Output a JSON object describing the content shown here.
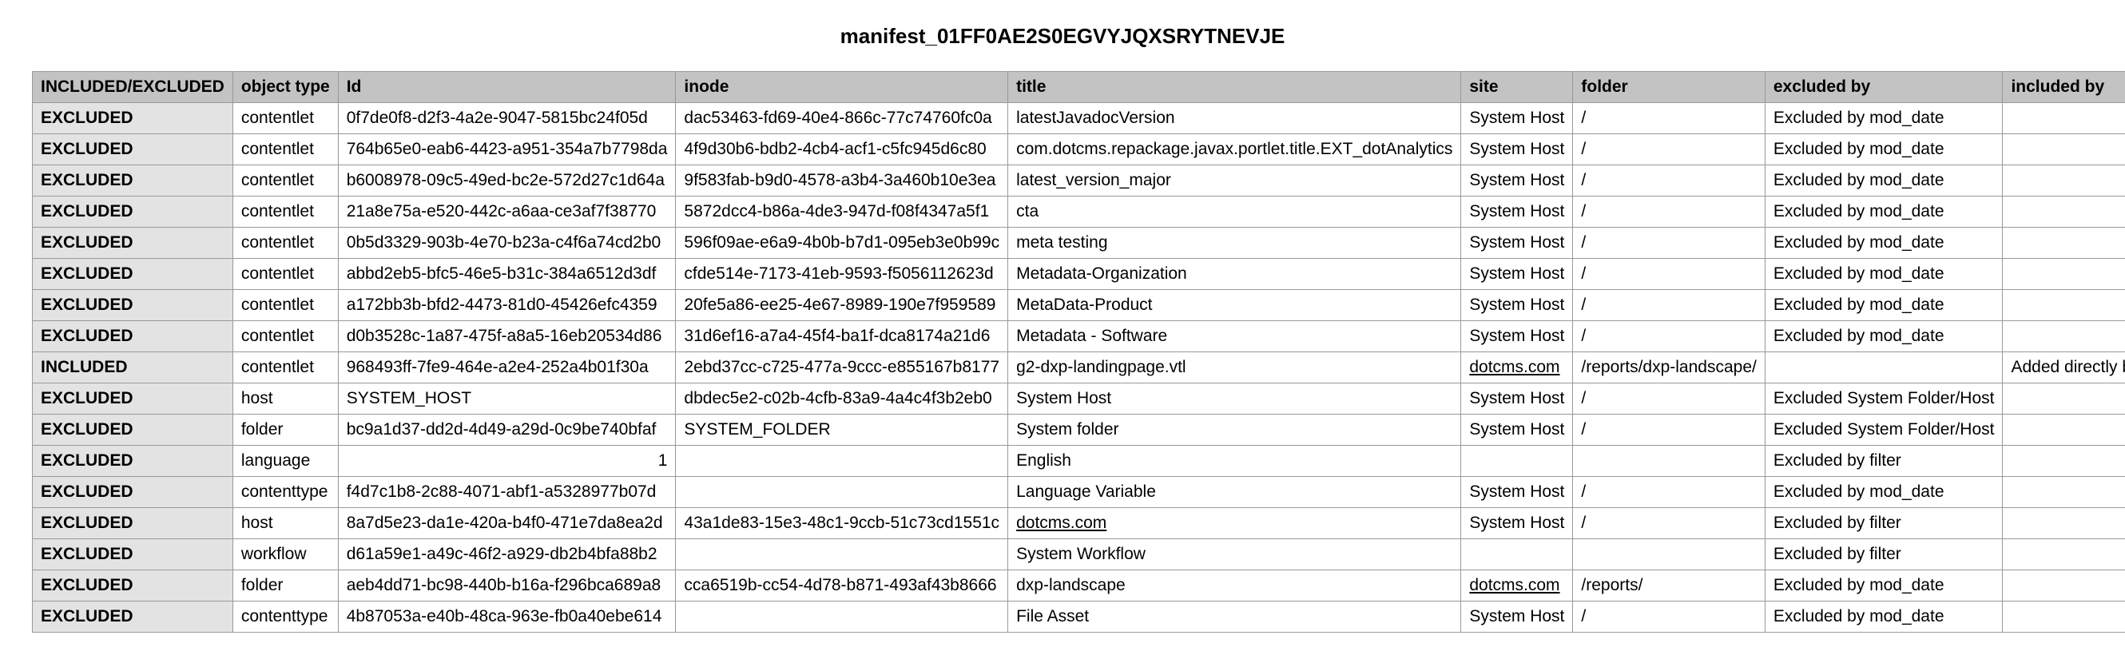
{
  "title": "manifest_01FF0AE2S0EGVYJQXSRYTNEVJE",
  "columns": [
    "INCLUDED/EXCLUDED",
    "object type",
    "Id",
    "inode",
    "title",
    "site",
    "folder",
    "excluded by",
    "included by"
  ],
  "rows": [
    {
      "status": "EXCLUDED",
      "type": "contentlet",
      "id": "0f7de0f8-d2f3-4a2e-9047-5815bc24f05d",
      "inode": "dac53463-fd69-40e4-866c-77c74760fc0a",
      "title": "latestJavadocVersion",
      "site": "System Host",
      "site_link": false,
      "folder": "/",
      "excluded": "Excluded by mod_date",
      "included": "",
      "id_right": false
    },
    {
      "status": "EXCLUDED",
      "type": "contentlet",
      "id": "764b65e0-eab6-4423-a951-354a7b7798da",
      "inode": "4f9d30b6-bdb2-4cb4-acf1-c5fc945d6c80",
      "title": "com.dotcms.repackage.javax.portlet.title.EXT_dotAnalytics",
      "site": "System Host",
      "site_link": false,
      "folder": "/",
      "excluded": "Excluded by mod_date",
      "included": "",
      "id_right": false
    },
    {
      "status": "EXCLUDED",
      "type": "contentlet",
      "id": "b6008978-09c5-49ed-bc2e-572d27c1d64a",
      "inode": "9f583fab-b9d0-4578-a3b4-3a460b10e3ea",
      "title": "latest_version_major",
      "site": "System Host",
      "site_link": false,
      "folder": "/",
      "excluded": "Excluded by mod_date",
      "included": "",
      "id_right": false
    },
    {
      "status": "EXCLUDED",
      "type": "contentlet",
      "id": "21a8e75a-e520-442c-a6aa-ce3af7f38770",
      "inode": "5872dcc4-b86a-4de3-947d-f08f4347a5f1",
      "title": "cta",
      "site": "System Host",
      "site_link": false,
      "folder": "/",
      "excluded": "Excluded by mod_date",
      "included": "",
      "id_right": false
    },
    {
      "status": "EXCLUDED",
      "type": "contentlet",
      "id": "0b5d3329-903b-4e70-b23a-c4f6a74cd2b0",
      "inode": "596f09ae-e6a9-4b0b-b7d1-095eb3e0b99c",
      "title": "meta testing",
      "site": "System Host",
      "site_link": false,
      "folder": "/",
      "excluded": "Excluded by mod_date",
      "included": "",
      "id_right": false
    },
    {
      "status": "EXCLUDED",
      "type": "contentlet",
      "id": "abbd2eb5-bfc5-46e5-b31c-384a6512d3df",
      "inode": "cfde514e-7173-41eb-9593-f5056112623d",
      "title": "Metadata-Organization",
      "site": "System Host",
      "site_link": false,
      "folder": "/",
      "excluded": "Excluded by mod_date",
      "included": "",
      "id_right": false
    },
    {
      "status": "EXCLUDED",
      "type": "contentlet",
      "id": "a172bb3b-bfd2-4473-81d0-45426efc4359",
      "inode": "20fe5a86-ee25-4e67-8989-190e7f959589",
      "title": "MetaData-Product",
      "site": "System Host",
      "site_link": false,
      "folder": "/",
      "excluded": "Excluded by mod_date",
      "included": "",
      "id_right": false
    },
    {
      "status": "EXCLUDED",
      "type": "contentlet",
      "id": "d0b3528c-1a87-475f-a8a5-16eb20534d86",
      "inode": "31d6ef16-a7a4-45f4-ba1f-dca8174a21d6",
      "title": "Metadata - Software",
      "site": "System Host",
      "site_link": false,
      "folder": "/",
      "excluded": "Excluded by mod_date",
      "included": "",
      "id_right": false
    },
    {
      "status": "INCLUDED",
      "type": "contentlet",
      "id": "968493ff-7fe9-464e-a2e4-252a4b01f30a",
      "inode": "2ebd37cc-c725-477a-9ccc-e855167b8177",
      "title": "g2-dxp-landingpage.vtl",
      "site": "dotcms.com",
      "site_link": true,
      "folder": "/reports/dxp-landscape/",
      "excluded": "",
      "included": "Added directly by User",
      "id_right": false
    },
    {
      "status": "EXCLUDED",
      "type": "host",
      "id": "SYSTEM_HOST",
      "inode": "dbdec5e2-c02b-4cfb-83a9-4a4c4f3b2eb0",
      "title": "System Host",
      "site": "System Host",
      "site_link": false,
      "folder": "/",
      "excluded": "Excluded System Folder/Host",
      "included": "",
      "id_right": false
    },
    {
      "status": "EXCLUDED",
      "type": "folder",
      "id": "bc9a1d37-dd2d-4d49-a29d-0c9be740bfaf",
      "inode": "SYSTEM_FOLDER",
      "title": "System folder",
      "site": "System Host",
      "site_link": false,
      "folder": "/",
      "excluded": "Excluded System Folder/Host",
      "included": "",
      "id_right": false
    },
    {
      "status": "EXCLUDED",
      "type": "language",
      "id": "1",
      "inode": "",
      "title": "English",
      "site": "",
      "site_link": false,
      "folder": "",
      "excluded": "Excluded by filter",
      "included": "",
      "id_right": true
    },
    {
      "status": "EXCLUDED",
      "type": "contenttype",
      "id": "f4d7c1b8-2c88-4071-abf1-a5328977b07d",
      "inode": "",
      "title": "Language Variable",
      "site": "System Host",
      "site_link": false,
      "folder": "/",
      "excluded": "Excluded by mod_date",
      "included": "",
      "id_right": false
    },
    {
      "status": "EXCLUDED",
      "type": "host",
      "id": "8a7d5e23-da1e-420a-b4f0-471e7da8ea2d",
      "inode": "43a1de83-15e3-48c1-9ccb-51c73cd1551c",
      "title": "dotcms.com",
      "title_link": true,
      "site": "System Host",
      "site_link": false,
      "folder": "/",
      "excluded": "Excluded by filter",
      "included": "",
      "id_right": false
    },
    {
      "status": "EXCLUDED",
      "type": "workflow",
      "id": "d61a59e1-a49c-46f2-a929-db2b4bfa88b2",
      "inode": "",
      "title": "System Workflow",
      "site": "",
      "site_link": false,
      "folder": "",
      "excluded": "Excluded by filter",
      "included": "",
      "id_right": false
    },
    {
      "status": "EXCLUDED",
      "type": "folder",
      "id": "aeb4dd71-bc98-440b-b16a-f296bca689a8",
      "inode": "cca6519b-cc54-4d78-b871-493af43b8666",
      "title": "dxp-landscape",
      "site": "dotcms.com",
      "site_link": true,
      "folder": "/reports/",
      "excluded": "Excluded by mod_date",
      "included": "",
      "id_right": false
    },
    {
      "status": "EXCLUDED",
      "type": "contenttype",
      "id": "4b87053a-e40b-48ca-963e-fb0a40ebe614",
      "inode": "",
      "title": "File Asset",
      "site": "System Host",
      "site_link": false,
      "folder": "/",
      "excluded": "Excluded by mod_date",
      "included": "",
      "id_right": false
    }
  ]
}
